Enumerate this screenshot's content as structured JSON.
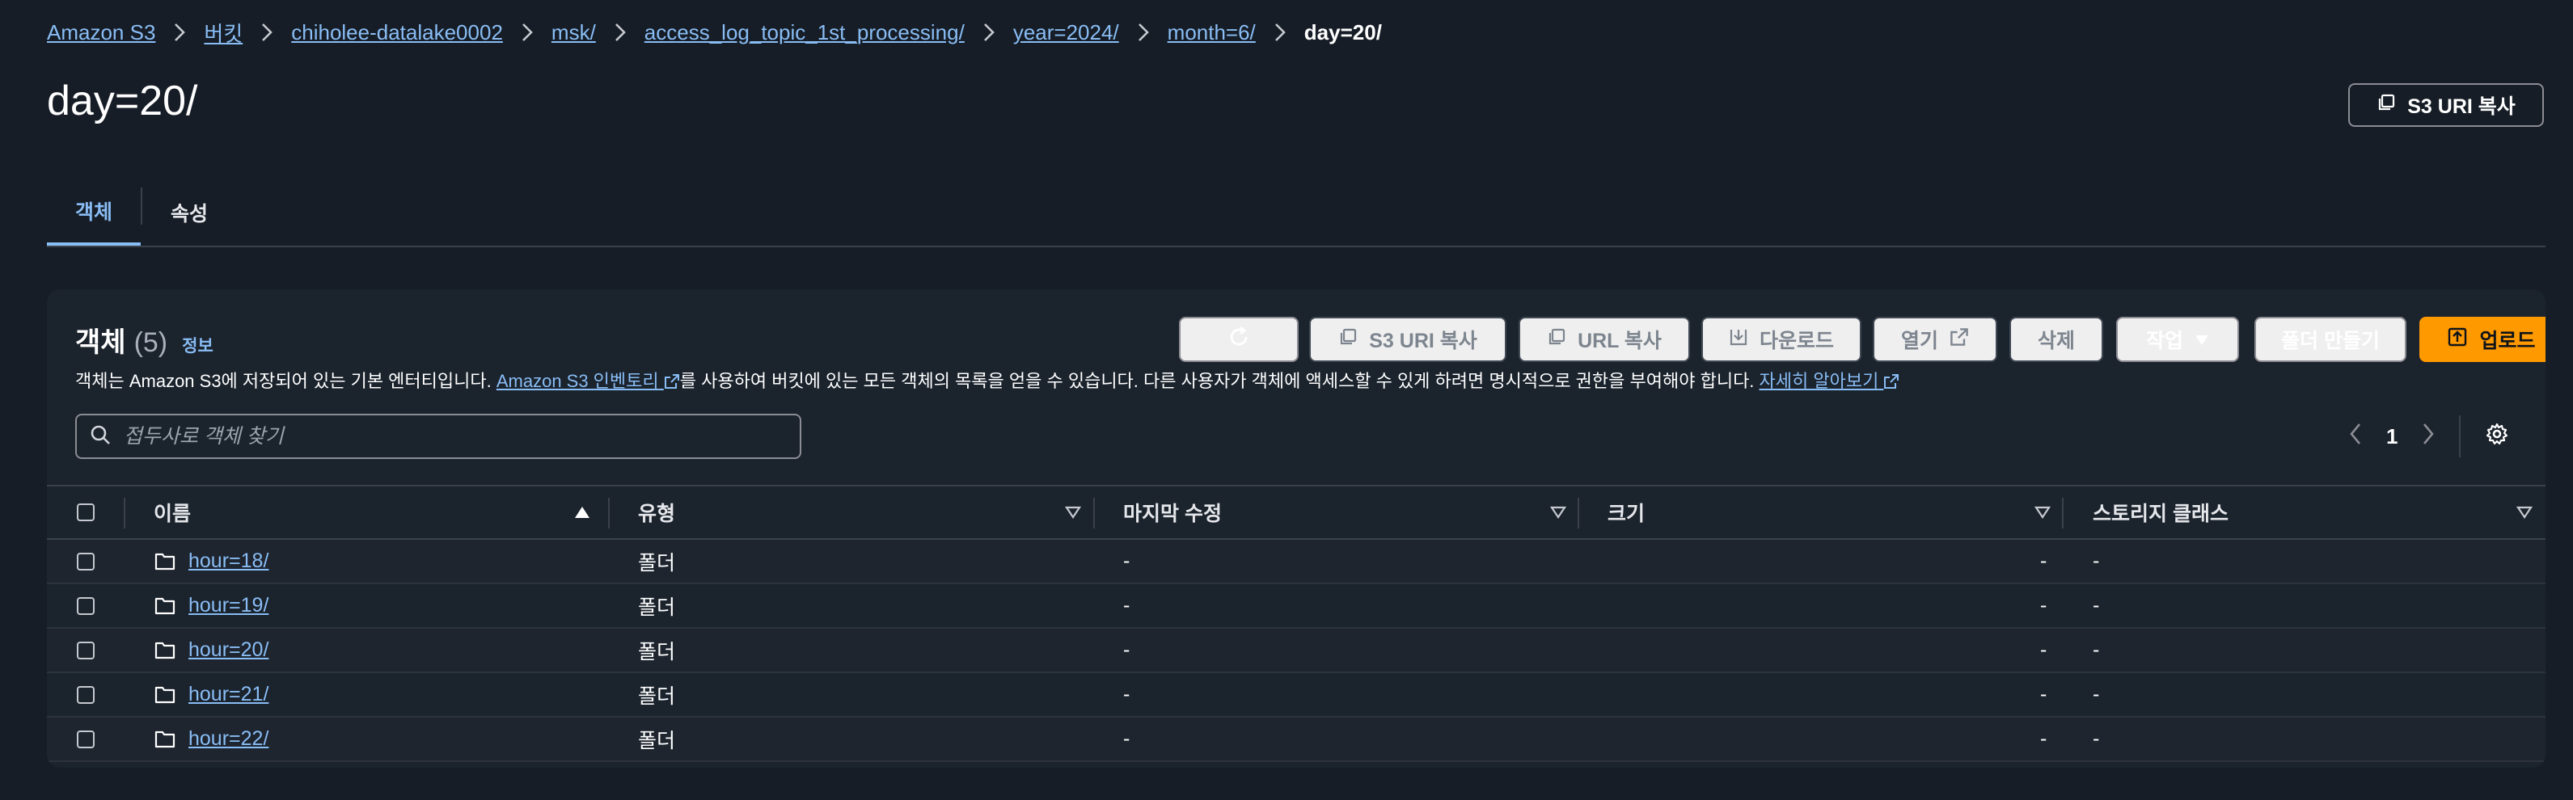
{
  "breadcrumb": [
    {
      "label": "Amazon S3"
    },
    {
      "label": "버킷"
    },
    {
      "label": "chiholee-datalake0002"
    },
    {
      "label": "msk/"
    },
    {
      "label": "access_log_topic_1st_processing/"
    },
    {
      "label": "year=2024/"
    },
    {
      "label": "month=6/"
    },
    {
      "label": "day=20/"
    }
  ],
  "page_title": "day=20/",
  "header_actions": {
    "copy_s3_uri": "S3 URI 복사"
  },
  "tabs": [
    {
      "label": "객체",
      "active": true
    },
    {
      "label": "속성",
      "active": false
    }
  ],
  "objects_panel": {
    "title": "객체",
    "count": "(5)",
    "info_link": "정보",
    "description_prefix": "객체는 Amazon S3에 저장되어 있는 기본 엔터티입니다. ",
    "description_link": "Amazon S3 인벤토리",
    "description_middle": "를 사용하여 버킷에 있는 모든 객체의 목록을 얻을 수 있습니다. 다른 사용자가 객체에 액세스할 수 있게 하려면 명시적으로 권한을 부여해야 합니다. ",
    "learn_more_link": "자세히 알아보기",
    "toolbar": {
      "copy_s3_uri": "S3 URI 복사",
      "copy_url": "URL 복사",
      "download": "다운로드",
      "open": "열기",
      "delete": "삭제",
      "actions": "작업",
      "create_folder": "폴더 만들기",
      "upload": "업로드"
    },
    "search_placeholder": "접두사로 객체 찾기",
    "pagination": {
      "current_page": "1"
    },
    "columns": [
      "이름",
      "유형",
      "마지막 수정",
      "크기",
      "스토리지 클래스"
    ],
    "rows": [
      {
        "name": "hour=18/",
        "type": "폴더",
        "last_modified": "-",
        "size": "-",
        "storage_class": "-"
      },
      {
        "name": "hour=19/",
        "type": "폴더",
        "last_modified": "-",
        "size": "-",
        "storage_class": "-"
      },
      {
        "name": "hour=20/",
        "type": "폴더",
        "last_modified": "-",
        "size": "-",
        "storage_class": "-"
      },
      {
        "name": "hour=21/",
        "type": "폴더",
        "last_modified": "-",
        "size": "-",
        "storage_class": "-"
      },
      {
        "name": "hour=22/",
        "type": "폴더",
        "last_modified": "-",
        "size": "-",
        "storage_class": "-"
      }
    ]
  },
  "colors": {
    "background": "#161d26",
    "panel": "#1b232d",
    "link": "#89bdf5",
    "primary": "#ff9900"
  }
}
